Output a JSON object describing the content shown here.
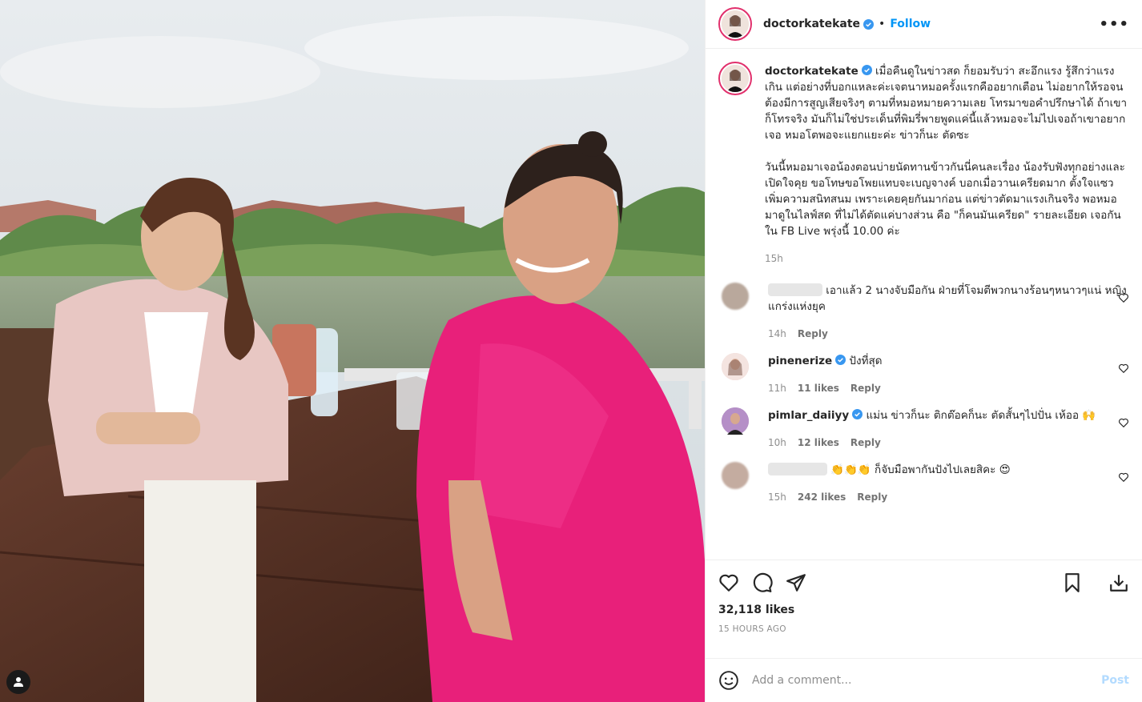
{
  "post": {
    "username": "doctorkatekate",
    "follow_label": "Follow",
    "dot": "•",
    "more": "•••"
  },
  "caption": {
    "username": "doctorkatekate",
    "para1": "เมื่อคืนดูในข่าวสด ก็ยอมรับว่า สะอึกแรง รู้สึกว่าแรงเกิน แต่อย่างที่บอกแหละค่ะเจตนาหมอครั้งแรกคืออยากเตือน ไม่อยากให้รอจนต้องมีการสูญเสียจริงๆ ตามที่หมอหมายความเลย โทรมาขอคำปรึกษาได้ ถ้าเขาก็โทรจริง มันก็ไม่ใช่ประเด็นที่พิมรี่พายพูดแค่นี้แล้วหมอจะไม่ไปเจอถ้าเขาอยากเจอ หมอโตพอจะแยกแยะค่ะ ข่าวก็นะ ตัดซะ",
    "para2": "วันนี้หมอมาเจอน้องตอนบ่ายนัดทานข้าวกันนี่คนละเรื่อง น้องรับฟังทุกอย่างและเปิดใจคุย ขอโทษขอโพยแทบจะเบญจางค์ บอกเมื่อวานเครียดมาก ตั้งใจแซวเพิ่มความสนิทสนม เพราะเคยคุยกันมาก่อน แต่ข่าวตัดมาแรงเกินจริง พอหมอมาดูในไลฟ์สด ที่ไม่ได้ตัดแค่บางส่วน คือ \"ก็คนมันเครียด\" รายละเอียด เจอกันใน FB Live พรุ่งนี้ 10.00 ค่ะ",
    "time": "15h"
  },
  "comments": [
    {
      "username": "",
      "text": "เอาแล้ว 2 นางจับมือกัน ฝ่ายที่โจมตีพวกนางร้อนๆหนาวๆแน่ หญิงแกร่งแห่งยุค",
      "time": "14h",
      "likes": "",
      "reply": "Reply",
      "avatar_color": "#b9a89c"
    },
    {
      "username": "pinenerize",
      "text": "ปังที่สุด",
      "time": "11h",
      "likes": "11 likes",
      "reply": "Reply",
      "avatar_color": "#e8c9c4"
    },
    {
      "username": "pimlar_daiiyy",
      "text": "แม่น ข่าวก็นะ ติกต๊อคก็นะ ตัดสั้นๆไปปั่น เห้ออ 🙌",
      "time": "10h",
      "likes": "12 likes",
      "reply": "Reply",
      "avatar_color": "#9c7ab0"
    },
    {
      "username": "",
      "text": "👏👏👏 ก็จับมือพากันปังไปเลยสิคะ 😍",
      "time": "15h",
      "likes": "242 likes",
      "reply": "Reply",
      "avatar_color": "#c4aca0"
    }
  ],
  "stats": {
    "likes": "32,118 likes",
    "ago": "15 HOURS AGO"
  },
  "add_comment": {
    "placeholder": "Add a comment...",
    "post_label": "Post"
  },
  "colors": {
    "accent": "#0095f6",
    "verified": "#3897f0",
    "dress": "#e8207a"
  }
}
